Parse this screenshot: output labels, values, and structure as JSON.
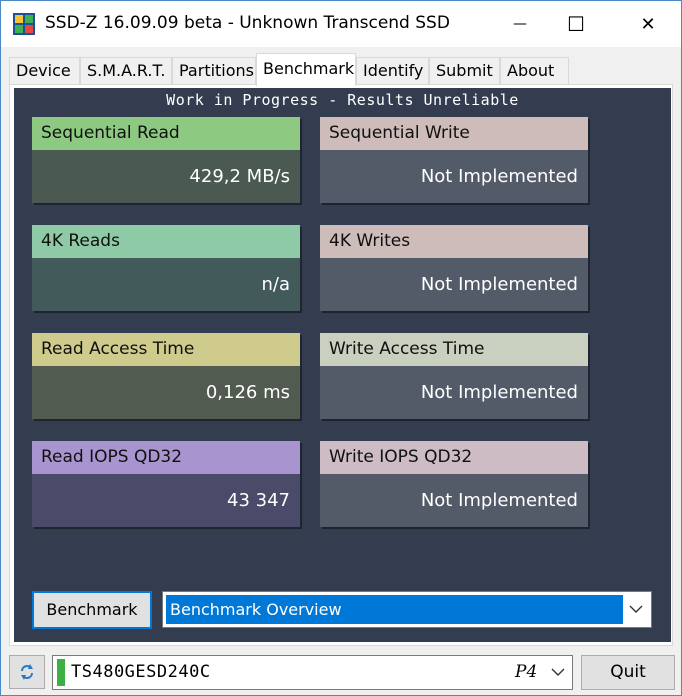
{
  "window": {
    "title": "SSD-Z 16.09.09 beta - Unknown Transcend SSD",
    "minimize_glyph": "—",
    "maximize_glyph": "☐",
    "close_glyph": "✕"
  },
  "tabs": [
    {
      "label": "Device"
    },
    {
      "label": "S.M.A.R.T."
    },
    {
      "label": "Partitions"
    },
    {
      "label": "Benchmark"
    },
    {
      "label": "Identify"
    },
    {
      "label": "Submit"
    },
    {
      "label": "About"
    }
  ],
  "active_tab": "Benchmark",
  "benchmark": {
    "header": "Work in Progress - Results Unreliable",
    "cards": [
      {
        "label": "Sequential Read",
        "value": "429,2 MB/s",
        "label_color": "#8ec982",
        "value_color": "#4a5a52"
      },
      {
        "label": "Sequential Write",
        "value": "Not Implemented",
        "label_color": "#cdbcba",
        "value_color": "#545b68"
      },
      {
        "label": "4K Reads",
        "value": "n/a",
        "label_color": "#8fcaa7",
        "value_color": "#425a5a"
      },
      {
        "label": "4K Writes",
        "value": "Not Implemented",
        "label_color": "#cdbcba",
        "value_color": "#545b68"
      },
      {
        "label": "Read Access Time",
        "value": "0,126 ms",
        "label_color": "#cfcb8c",
        "value_color": "#515b50"
      },
      {
        "label": "Write Access Time",
        "value": "Not Implemented",
        "label_color": "#c9d0c0",
        "value_color": "#545b68"
      },
      {
        "label": "Read IOPS QD32",
        "value": "43 347",
        "label_color": "#a895cf",
        "value_color": "#4a4b68"
      },
      {
        "label": "Write IOPS QD32",
        "value": "Not Implemented",
        "label_color": "#cdbcc4",
        "value_color": "#545b68"
      }
    ],
    "run_button_label": "Benchmark",
    "mode_select_value": "Benchmark Overview"
  },
  "footer": {
    "refresh_icon": "refresh-icon",
    "drive_model": "TS480GESD240C",
    "drive_port": "P4",
    "quit_label": "Quit"
  },
  "colors": {
    "panel_background": "#333d4f",
    "selection_blue": "#0078d7",
    "drive_led": "#3cb043"
  }
}
